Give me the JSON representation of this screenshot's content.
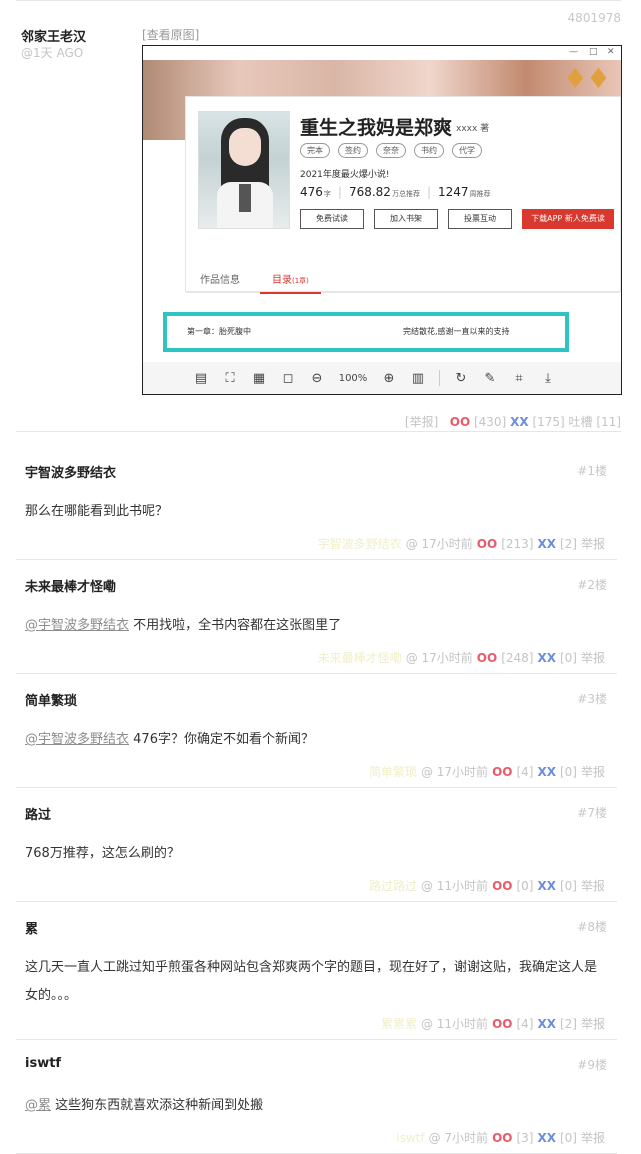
{
  "post": {
    "id": "4801978",
    "author": "邻家王老汉",
    "ago": "@1天 AGO",
    "view_original": "[查看原图]",
    "footer": {
      "report": "[举报]",
      "oo_label": "OO",
      "oo_count": "[430]",
      "xx_label": "XX",
      "xx_count": "[175]",
      "tucao": "吐槽 [11]"
    },
    "screenshot": {
      "book_title": "重生之我妈是郑爽",
      "book_author": "xxxx 著",
      "tags": [
        "完本",
        "签约",
        "奈奈",
        "书约",
        "代学"
      ],
      "intro": "2021年度最火爆小说!",
      "stats": [
        {
          "num": "476",
          "unit": "字"
        },
        {
          "num": "768.82",
          "unit": "万总推荐"
        },
        {
          "num": "1247",
          "unit": "周推荐"
        }
      ],
      "buttons": {
        "trial": "免费试读",
        "shelf": "加入书架",
        "vote": "投票互动",
        "download": "下载APP 新人免费读"
      },
      "tab_info": "作品信息",
      "tab_catalog": "目录",
      "tab_catalog_count": "(1章)",
      "chapter_left": "第一章：胎死腹中",
      "chapter_right": "完结散花,感谢一直以来的支持",
      "zoom": "100%"
    }
  },
  "comments": [
    {
      "author": "宇智波多野结衣",
      "floor": "#1楼",
      "mention": "",
      "text": "那么在哪能看到此书呢？",
      "blur": "宇智波多野结衣",
      "time": "@ 17小时前",
      "oo": "[213]",
      "xx": "[2]",
      "report": "举报"
    },
    {
      "author": "未来最棒才怪嘞",
      "floor": "#2楼",
      "mention": "@宇智波多野结衣",
      "text": " 不用找啦，全书内容都在这张图里了",
      "blur": "未来最棒才怪嘞",
      "time": "@ 17小时前",
      "oo": "[248]",
      "xx": "[0]",
      "report": "举报"
    },
    {
      "author": "简单繁琐",
      "floor": "#3楼",
      "mention": "@宇智波多野结衣",
      "text": " 476字？你确定不如看个新闻？",
      "blur": "简单繁琐",
      "time": "@ 17小时前",
      "oo": "[4]",
      "xx": "[0]",
      "report": "举报"
    },
    {
      "author": "路过",
      "floor": "#7楼",
      "mention": "",
      "text": "768万推荐，这怎么刷的？",
      "blur": "路过路过",
      "time": "@ 11小时前",
      "oo": "[0]",
      "xx": "[0]",
      "report": "举报"
    },
    {
      "author": "累",
      "floor": "#8楼",
      "mention": "",
      "text": "这几天一直人工跳过知乎煎蛋各种网站包含郑爽两个字的题目，现在好了，谢谢这贴，我确定这人是女的。。。",
      "blur": "累累累",
      "time": "@ 11小时前",
      "oo": "[4]",
      "xx": "[2]",
      "report": "举报"
    },
    {
      "author": "iswtf",
      "floor": "#9楼",
      "mention": "@累",
      "text": " 这些狗东西就喜欢添这种新闻到处搬",
      "blur": "iswtf",
      "time": "@ 7小时前",
      "oo": "[3]",
      "xx": "[0]",
      "report": "举报"
    }
  ],
  "labels": {
    "oo": "OO",
    "xx": "XX"
  }
}
